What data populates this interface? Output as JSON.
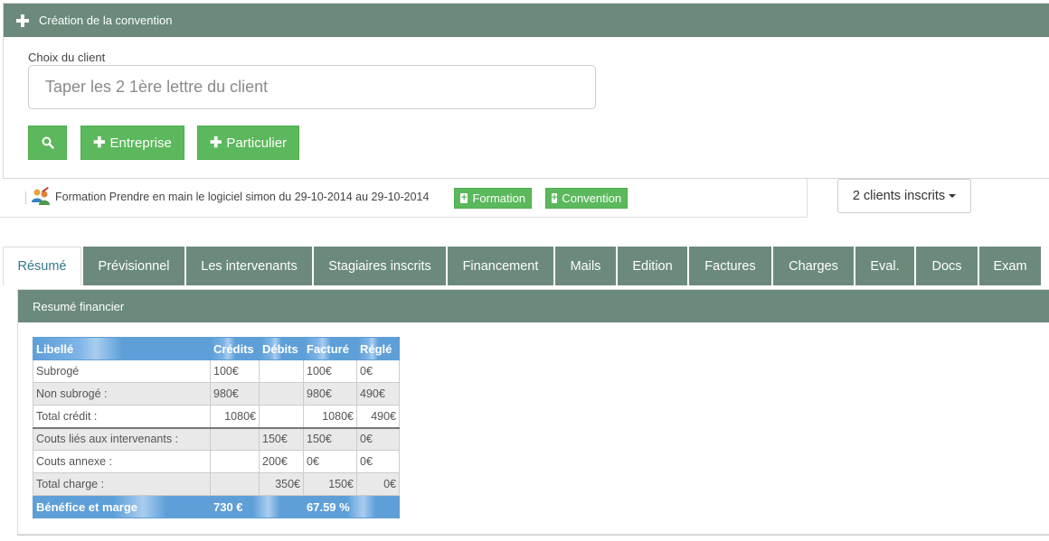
{
  "top_panel": {
    "title": "Création de la convention",
    "client_label": "Choix du client",
    "client_placeholder": "Taper les 2 1ère lettre du client",
    "btn_entreprise": "Entreprise",
    "btn_particulier": "Particulier"
  },
  "formation": {
    "text": "Formation Prendre en main le logiciel simon du 29-10-2014 au 29-10-2014",
    "btn_formation": "Formation",
    "btn_convention": "Convention",
    "clients_dropdown": "2 clients inscrits"
  },
  "tabs": [
    {
      "label": "Résumé"
    },
    {
      "label": "Prévisionnel"
    },
    {
      "label": "Les intervenants"
    },
    {
      "label": "Stagiaires inscrits"
    },
    {
      "label": "Financement"
    },
    {
      "label": "Mails"
    },
    {
      "label": "Edition"
    },
    {
      "label": "Factures"
    },
    {
      "label": "Charges"
    },
    {
      "label": "Eval."
    },
    {
      "label": "Docs"
    },
    {
      "label": "Exam"
    }
  ],
  "resume": {
    "title": "Resumé financier",
    "columns": [
      "Libellé",
      "Crédits",
      "Débits",
      "Facturé",
      "Réglé"
    ],
    "rows": [
      [
        "Subrogé",
        "100€",
        "",
        "100€",
        "0€"
      ],
      [
        "Non subrogé :",
        "980€",
        "",
        "980€",
        "490€"
      ],
      [
        "Total crédit :",
        "1080€",
        "",
        "1080€",
        "490€"
      ],
      [
        "Couts liés aux intervenants :",
        "",
        "150€",
        "150€",
        "0€"
      ],
      [
        "Couts annexe :",
        "",
        "200€",
        "0€",
        "0€"
      ],
      [
        "Total charge :",
        "",
        "350€",
        "150€",
        "0€"
      ]
    ],
    "footer": {
      "label": "Bénéfice et marge",
      "benefice": "730 €",
      "marge": "67.59 %"
    }
  },
  "colors": {
    "header_green": "#6b8a7b",
    "button_green": "#5cb85c",
    "table_blue": "#5e9fd8",
    "tab_active_text": "#337a8f"
  }
}
